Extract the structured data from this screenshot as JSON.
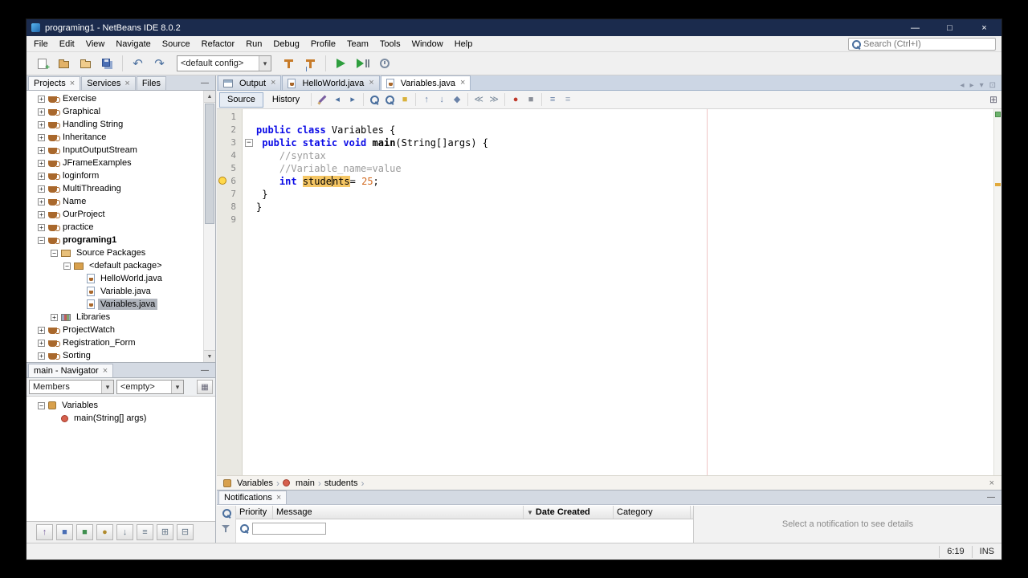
{
  "colors": {
    "titlebar": "#1b2b4d",
    "run_green": "#2e9e3e",
    "keyword": "#0a0ae6",
    "comment": "#9b9b9b",
    "number_literal": "#d2691e",
    "occurrence_highlight": "#f5c664",
    "margin_line": "#efc4c4",
    "selection_gray": "#b0b5bd"
  },
  "glyphs": {
    "close": "×",
    "panel_minimize": "—",
    "chevron_down": "▾",
    "expand_plus": "+",
    "expand_minus": "−",
    "fold_minus": "−",
    "scroll_up": "▲",
    "scroll_down": "▼",
    "breadcrumb_chevron": "›",
    "nav_filter_grid": "▦"
  },
  "titlebar": {
    "title": "programing1 - NetBeans IDE 8.0.2",
    "minimize_glyph": "—",
    "maximize_glyph": "□",
    "close_glyph": "×"
  },
  "menubar": {
    "items": [
      "File",
      "Edit",
      "View",
      "Navigate",
      "Source",
      "Refactor",
      "Run",
      "Debug",
      "Profile",
      "Team",
      "Tools",
      "Window",
      "Help"
    ],
    "search_placeholder": "Search (Ctrl+I)"
  },
  "toolbar": {
    "buttons": [
      {
        "name": "new-file-button",
        "icon": "file"
      },
      {
        "name": "new-project-button",
        "icon": "newproject"
      },
      {
        "name": "open-project-button",
        "icon": "openproject"
      },
      {
        "name": "save-all-button",
        "icon": "saveall"
      },
      {
        "sep": true
      },
      {
        "name": "undo-button",
        "icon": "glyph",
        "glyph": "↶",
        "color": "#4a6f9e"
      },
      {
        "name": "redo-button",
        "icon": "glyph",
        "glyph": "↷",
        "color": "#4a6f9e"
      },
      {
        "combo": true,
        "name": "config-combo",
        "value": "<default config>"
      },
      {
        "name": "build-project-button",
        "icon": "build"
      },
      {
        "name": "clean-build-project-button",
        "icon": "cleanbuild"
      },
      {
        "sep": true
      },
      {
        "name": "run-project-button",
        "icon": "run"
      },
      {
        "name": "debug-project-button",
        "icon": "debug"
      },
      {
        "name": "profile-project-button",
        "icon": "profile"
      }
    ]
  },
  "projects": {
    "tabs": [
      {
        "label": "Projects",
        "active": true,
        "closable": true
      },
      {
        "label": "Services",
        "closable": true
      },
      {
        "label": "Files",
        "closable": false
      }
    ],
    "tree": [
      {
        "label": "Exercise",
        "level": 0,
        "expand": "plus",
        "icon": "project"
      },
      {
        "label": "Graphical",
        "level": 0,
        "expand": "plus",
        "icon": "project"
      },
      {
        "label": "Handling String",
        "level": 0,
        "expand": "plus",
        "icon": "project"
      },
      {
        "label": "Inheritance",
        "level": 0,
        "expand": "plus",
        "icon": "project"
      },
      {
        "label": "InputOutputStream",
        "level": 0,
        "expand": "plus",
        "icon": "project"
      },
      {
        "label": "JFrameExamples",
        "level": 0,
        "expand": "plus",
        "icon": "project"
      },
      {
        "label": "loginform",
        "level": 0,
        "expand": "plus",
        "icon": "project"
      },
      {
        "label": "MultiThreading",
        "level": 0,
        "expand": "plus",
        "icon": "project"
      },
      {
        "label": "Name",
        "level": 0,
        "expand": "plus",
        "icon": "project"
      },
      {
        "label": "OurProject",
        "level": 0,
        "expand": "plus",
        "icon": "project"
      },
      {
        "label": "practice",
        "level": 0,
        "expand": "plus",
        "icon": "project"
      },
      {
        "label": "programing1",
        "level": 0,
        "expand": "minus",
        "icon": "project",
        "bold": true
      },
      {
        "label": "Source Packages",
        "level": 1,
        "expand": "minus",
        "icon": "srcpkg"
      },
      {
        "label": "<default package>",
        "level": 2,
        "expand": "minus",
        "icon": "package"
      },
      {
        "label": "HelloWorld.java",
        "level": 3,
        "icon": "javafile"
      },
      {
        "label": "Variable.java",
        "level": 3,
        "icon": "javafile"
      },
      {
        "label": "Variables.java",
        "level": 3,
        "icon": "javafile",
        "selected": true
      },
      {
        "label": "Libraries",
        "level": 1,
        "expand": "plus",
        "icon": "libraries"
      },
      {
        "label": "ProjectWatch",
        "level": 0,
        "expand": "plus",
        "icon": "project"
      },
      {
        "label": "Registration_Form",
        "level": 0,
        "expand": "plus",
        "icon": "project"
      },
      {
        "label": "Sorting",
        "level": 0,
        "expand": "plus",
        "icon": "project"
      }
    ]
  },
  "navigator": {
    "tab_label": "main - Navigator",
    "filters": [
      "Members",
      "<empty>"
    ],
    "tree": [
      {
        "label": "Variables",
        "level": 0,
        "expand": "minus",
        "icon": "class"
      },
      {
        "label": "main(String[] args)",
        "level": 1,
        "icon": "method"
      }
    ],
    "mini_toolbar": [
      {
        "name": "show-inherited-members-button",
        "glyph": "↑",
        "color": "#7a5fa0"
      },
      {
        "name": "show-fields-button",
        "glyph": "■",
        "color": "#4a6fb5"
      },
      {
        "name": "show-static-members-button",
        "glyph": "■",
        "color": "#3f8f4f"
      },
      {
        "name": "show-non-public-members-button",
        "glyph": "●",
        "color": "#b08b2e"
      },
      {
        "name": "sort-by-name-button",
        "glyph": "↓",
        "color": "#667788"
      },
      {
        "name": "sort-by-source-button",
        "glyph": "≡",
        "color": "#667788"
      },
      {
        "name": "expand-all-button",
        "glyph": "⊞",
        "color": "#667788"
      },
      {
        "name": "collapse-all-button",
        "glyph": "⊟",
        "color": "#667788"
      }
    ]
  },
  "editor": {
    "tabs": [
      {
        "label": "Output",
        "icon": "output",
        "closable": true
      },
      {
        "label": "HelloWorld.java",
        "icon": "javafile",
        "closable": true
      },
      {
        "label": "Variables.java",
        "icon": "javafile",
        "closable": true,
        "active": true
      }
    ],
    "tab_controls": [
      {
        "name": "scroll-tabs-left-button",
        "glyph": "◂"
      },
      {
        "name": "scroll-tabs-right-button",
        "glyph": "▸"
      },
      {
        "name": "tab-list-button",
        "glyph": "▾"
      },
      {
        "name": "maximize-document-button",
        "glyph": "⊡"
      }
    ],
    "views": [
      "Source",
      "History"
    ],
    "split_glyph": "⊞",
    "toolbar_icons": [
      {
        "name": "last-edit-icon",
        "cls": "pencil"
      },
      {
        "name": "back-icon",
        "glyph": "◂",
        "color": "#4a6f9e"
      },
      {
        "name": "forward-icon",
        "glyph": "▸",
        "color": "#4a6f9e"
      },
      {
        "sep": true
      },
      {
        "name": "find-selection-icon",
        "cls": "mag"
      },
      {
        "name": "find-occurrence-icon",
        "cls": "mag"
      },
      {
        "name": "toggle-highlight-search-icon",
        "glyph": "■",
        "color": "#d9b23c"
      },
      {
        "sep": true
      },
      {
        "name": "previous-bookmark-icon",
        "glyph": "↑",
        "color": "#6a82a8"
      },
      {
        "name": "next-bookmark-icon",
        "glyph": "↓",
        "color": "#6a82a8"
      },
      {
        "name": "toggle-bookmark-icon",
        "glyph": "◆",
        "color": "#6a82a8"
      },
      {
        "sep": true
      },
      {
        "name": "shift-line-left-icon",
        "glyph": "≪",
        "color": "#778899"
      },
      {
        "name": "shift-line-right-icon",
        "glyph": "≫",
        "color": "#778899"
      },
      {
        "sep": true
      },
      {
        "name": "start-macro-recording-icon",
        "glyph": "●",
        "color": "#c0392b"
      },
      {
        "name": "stop-macro-recording-icon",
        "glyph": "■",
        "color": "#8a8f98"
      },
      {
        "sep": true
      },
      {
        "name": "comment-icon",
        "glyph": "≡",
        "color": "#6a82a8"
      },
      {
        "name": "uncomment-icon",
        "glyph": "≡",
        "color": "#9aa8bc"
      }
    ],
    "code": [
      {
        "n": "1",
        "tokens": []
      },
      {
        "n": "2",
        "tokens": [
          {
            "c": "kw",
            "t": "public class"
          },
          {
            "c": "pl",
            "t": " Variables {"
          }
        ]
      },
      {
        "n": "3",
        "fold": true,
        "tokens": [
          {
            "c": "pl",
            "t": " "
          },
          {
            "c": "kw",
            "t": "public static void"
          },
          {
            "c": "pl",
            "t": " "
          },
          {
            "c": "bd",
            "t": "main"
          },
          {
            "c": "pl",
            "t": "(String[]args) {"
          }
        ]
      },
      {
        "n": "4",
        "tokens": [
          {
            "c": "pl",
            "t": "    "
          },
          {
            "c": "cm",
            "t": "//syntax"
          }
        ]
      },
      {
        "n": "5",
        "tokens": [
          {
            "c": "pl",
            "t": "    "
          },
          {
            "c": "cm",
            "t": "//Variable_name=value"
          }
        ]
      },
      {
        "n": "6",
        "bulb": true,
        "tokens": [
          {
            "c": "pl",
            "t": "    "
          },
          {
            "c": "kw",
            "t": "int"
          },
          {
            "c": "pl",
            "t": " "
          },
          {
            "c": "hl",
            "t": "stude"
          },
          {
            "caret": true
          },
          {
            "c": "hl",
            "t": "nts"
          },
          {
            "c": "pl",
            "t": "= "
          },
          {
            "c": "num",
            "t": "25"
          },
          {
            "c": "pl",
            "t": ";"
          }
        ]
      },
      {
        "n": "7",
        "tokens": [
          {
            "c": "pl",
            "t": " }"
          }
        ]
      },
      {
        "n": "8",
        "tokens": [
          {
            "c": "pl",
            "t": "}"
          }
        ]
      },
      {
        "n": "9",
        "tokens": []
      }
    ],
    "breadcrumb": [
      {
        "label": "Variables",
        "icon": "class"
      },
      {
        "label": "main",
        "icon": "method"
      },
      {
        "label": "students"
      }
    ]
  },
  "notifications": {
    "tab_label": "Notifications",
    "columns": [
      "Priority",
      "Message",
      "Date Created",
      "Category"
    ],
    "sorted_column": 2,
    "sort_glyph": "▼",
    "details_placeholder": "Select a notification to see details"
  },
  "statusbar": {
    "caret_position": "6:19",
    "insert_mode": "INS"
  }
}
